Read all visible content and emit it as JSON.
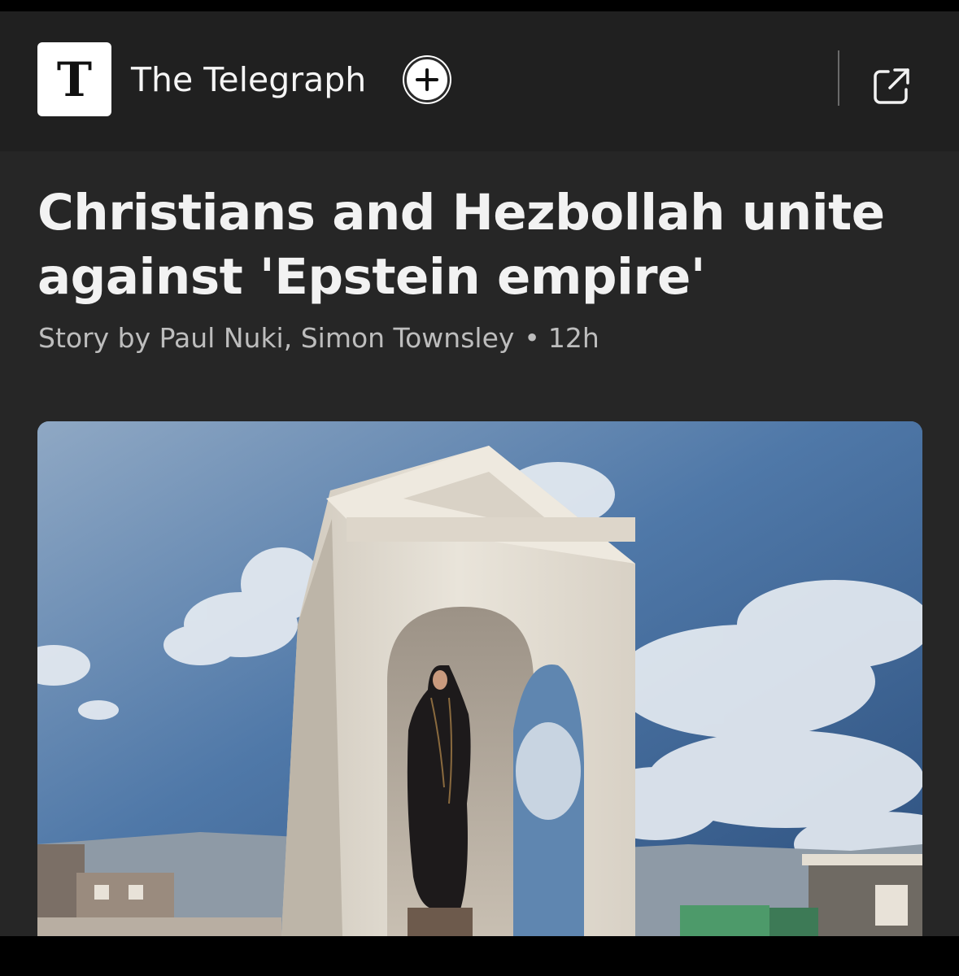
{
  "header": {
    "publisher_logo_letter": "T",
    "publisher_name": "The Telegraph",
    "follow_icon": "plus-circle-icon",
    "open_icon": "external-link-icon"
  },
  "article": {
    "headline": "Christians and Hezbollah unite against 'Epstein empire'",
    "byline_authors": "Story by Paul Nuki, Simon Townsley",
    "byline_separator": "•",
    "byline_time": "12h",
    "image_subject": "statue-shrine-photo"
  },
  "colors": {
    "header_bg": "#202020",
    "body_bg": "#262626",
    "headline_text": "#f2f2f2",
    "byline_text": "#bdbdbd"
  }
}
